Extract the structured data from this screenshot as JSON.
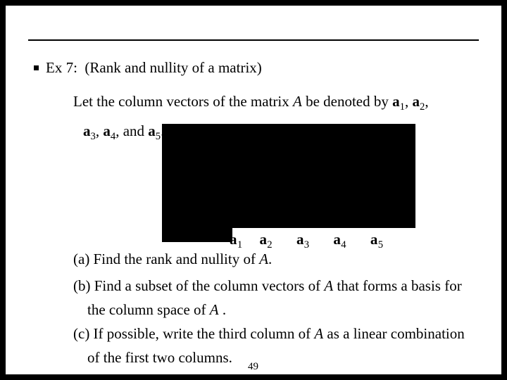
{
  "title_prefix": "Ex 7:",
  "title_rest": "(Rank and nullity of a matrix)",
  "intro_pre": "Let the column vectors of the matrix ",
  "intro_A": "A",
  "intro_post": " be denoted by ",
  "a1": "a",
  "s1": "1",
  "a2": "a",
  "s2": "2",
  "a3": "a",
  "s3": "3",
  "a4": "a",
  "s4": "4",
  "a5": "a",
  "s5": "5",
  "and_txt": ", and ",
  "period": ".",
  "comma": ", ",
  "part_a_pre": "(a) Find the rank and nullity of ",
  "part_a_A": "A",
  "part_a_post": ".",
  "part_b_pre": "(b) Find a subset of the column vectors of ",
  "part_b_A": "A",
  "part_b_post": " that forms a basis for",
  "part_b2_pre": "the column space of  ",
  "part_b2_A": "A",
  "part_b2_post": " .",
  "part_c_pre": "(c) If possible, write the third column of  ",
  "part_c_A": "A",
  "part_c_post": "  as a linear combination",
  "part_c2": "of the first two columns.",
  "page": "49"
}
